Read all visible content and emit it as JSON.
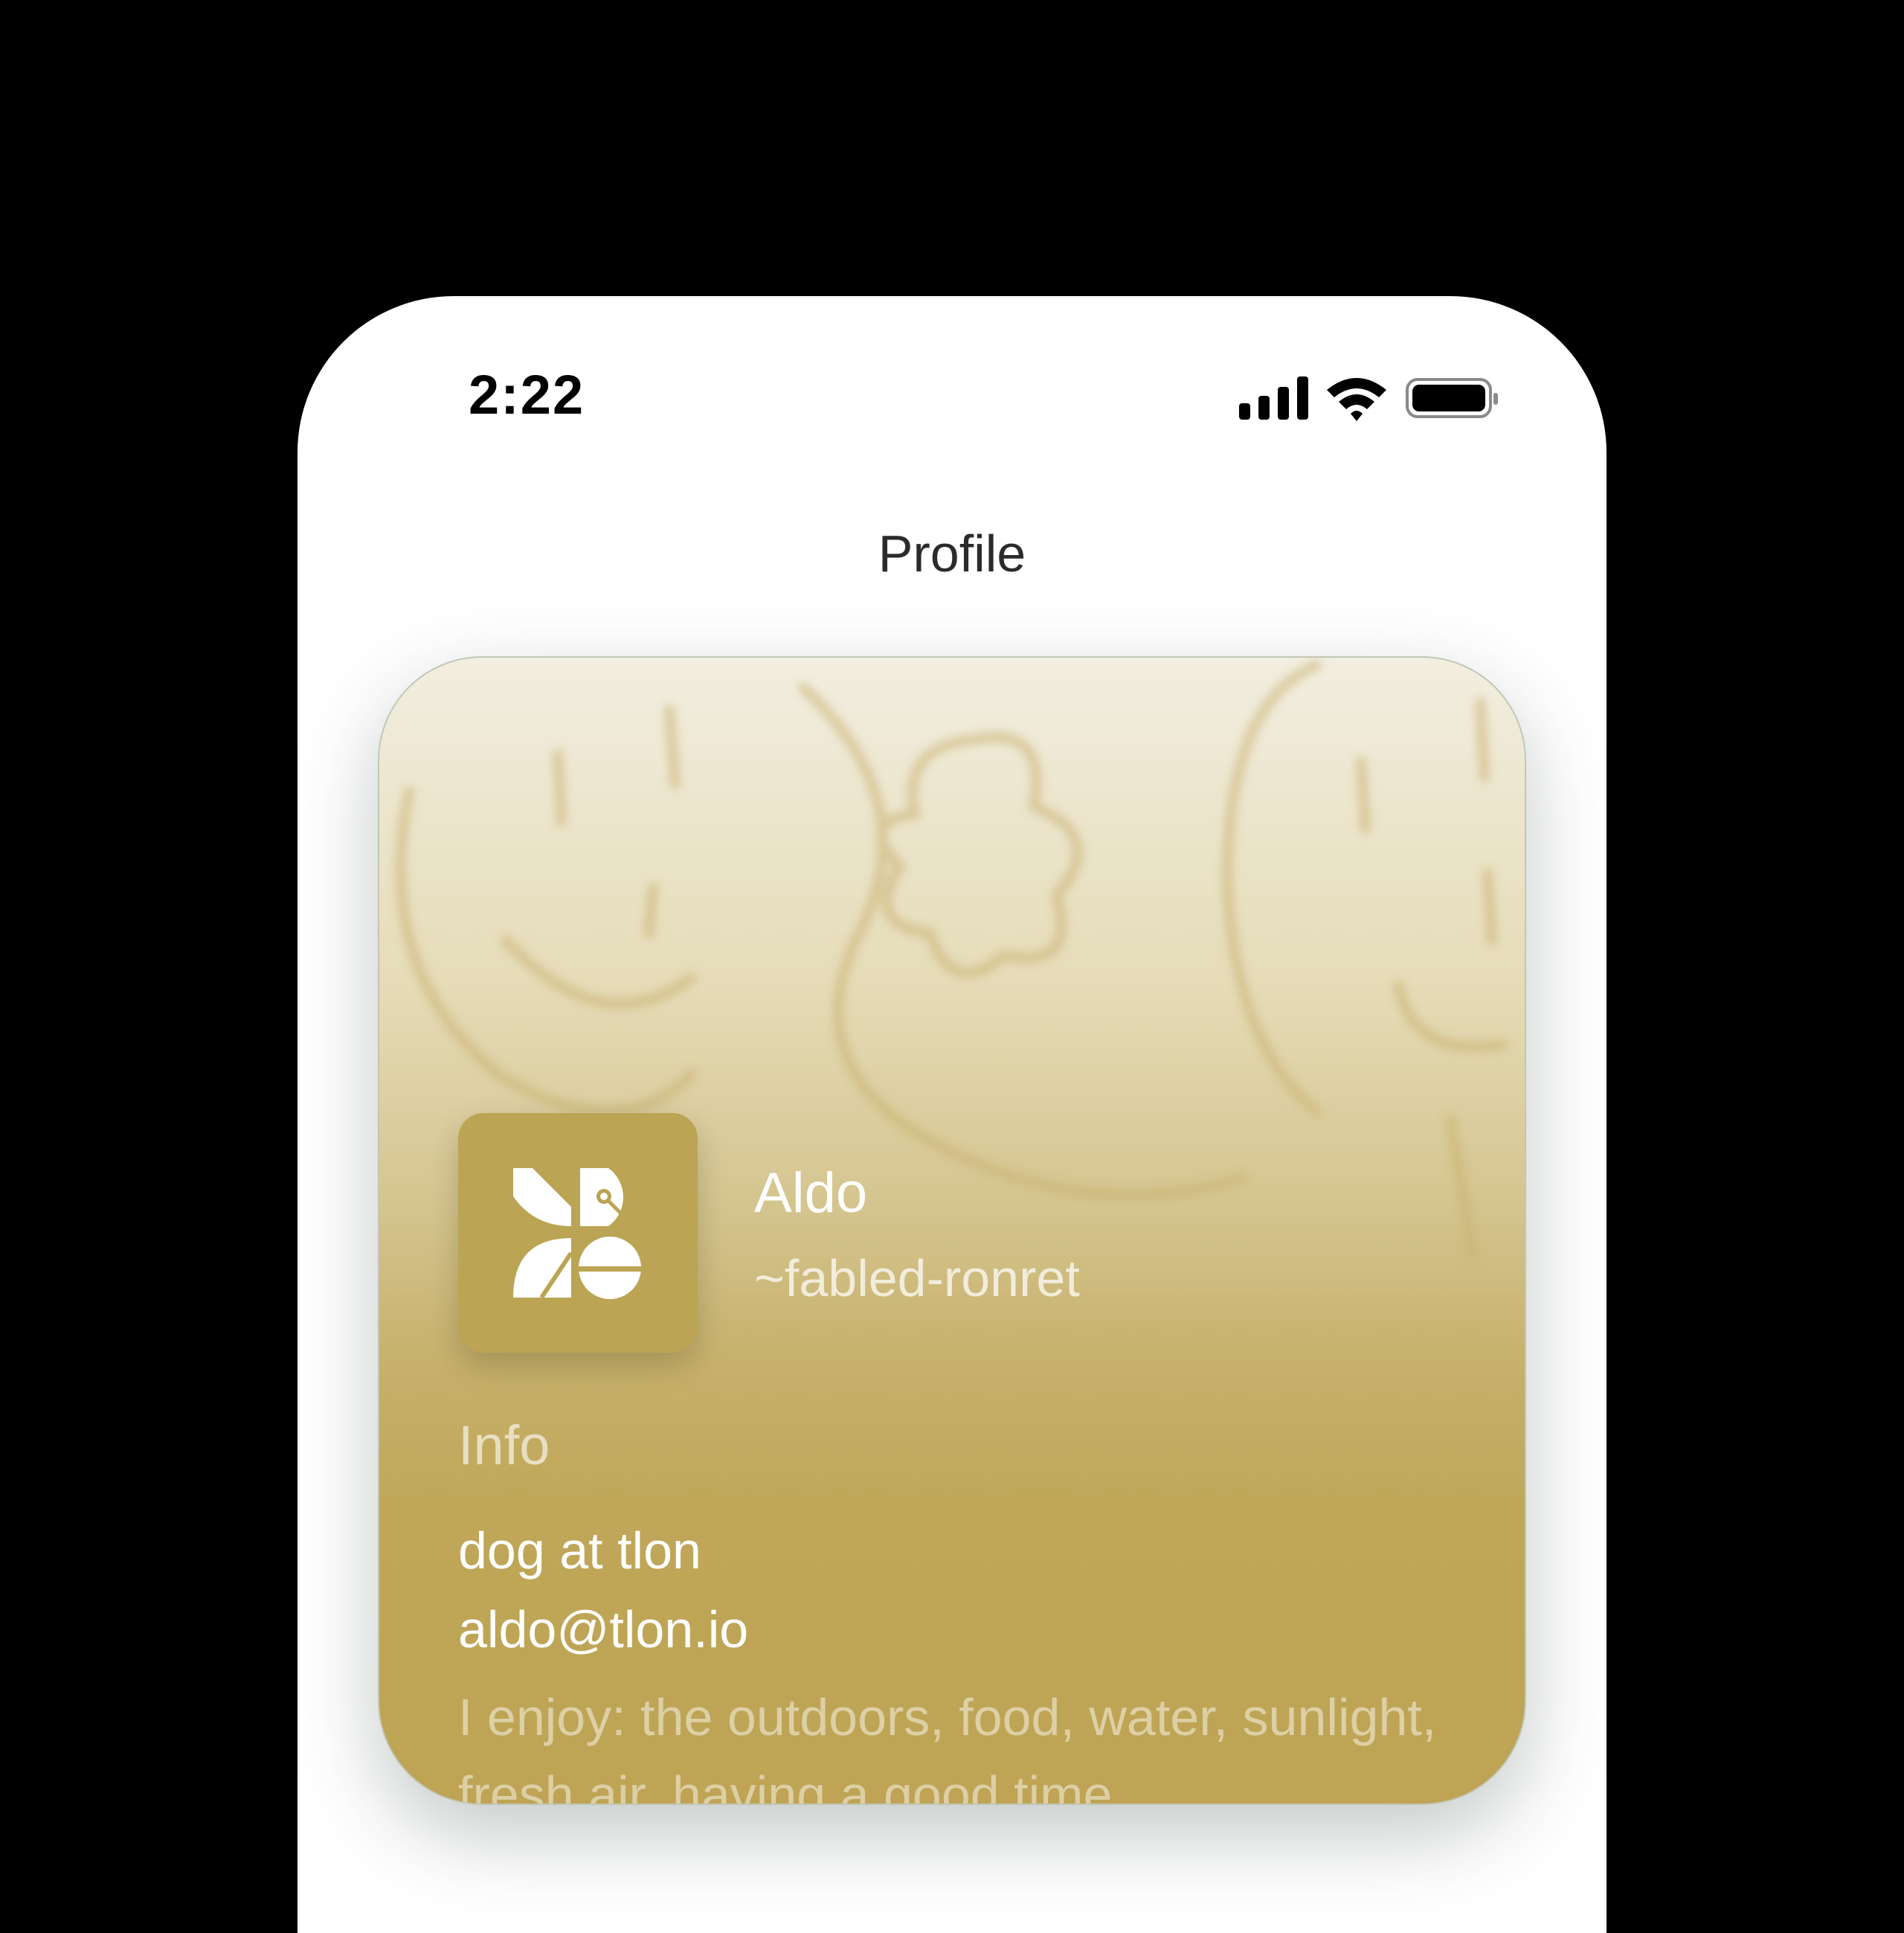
{
  "status_bar": {
    "time": "2:22"
  },
  "header": {
    "title": "Profile"
  },
  "profile": {
    "name": "Aldo",
    "handle": "~fabled-ronret",
    "info_label": "Info",
    "lines": [
      "dog at tlon",
      "aldo@tlon.io"
    ],
    "bio": "I enjoy: the outdoors, food, water, sunlight, fresh air, having a good time"
  },
  "colors": {
    "card_gold": "#bea454",
    "avatar_bg": "#bba453"
  },
  "icons": {
    "signal": "signal-icon",
    "wifi": "wifi-icon",
    "battery": "battery-icon",
    "avatar": "sigil-avatar-icon"
  }
}
